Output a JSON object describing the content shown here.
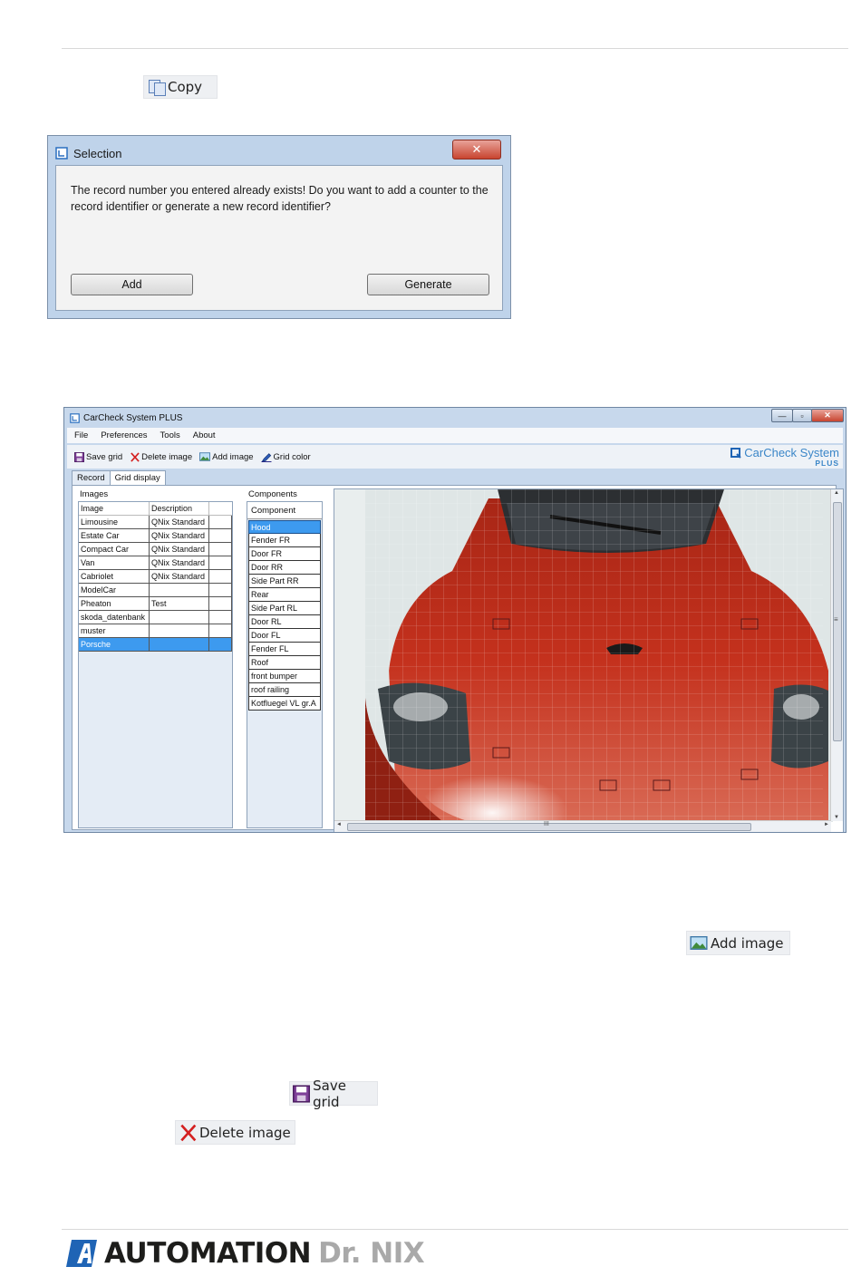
{
  "doc": {
    "copy_label": "Copy",
    "add_image_label": "Add image",
    "save_grid_label": "Save grid",
    "delete_image_label": "Delete image"
  },
  "dialog": {
    "title": "Selection",
    "close_glyph": "✕",
    "message": "The record number you entered already exists! Do you want to add a counter to the record identifier or generate a new record identifier?",
    "add_button": "Add",
    "generate_button": "Generate"
  },
  "app": {
    "title": "CarCheck System PLUS",
    "window_controls": {
      "minimize": "—",
      "maximize": "▫",
      "close": "✕"
    },
    "menu": [
      "File",
      "Preferences",
      "Tools",
      "About"
    ],
    "toolbar": {
      "save_grid": "Save grid",
      "delete_image": "Delete image",
      "add_image": "Add image",
      "grid_color": "Grid color"
    },
    "brand": {
      "name": "CarCheck System",
      "plus": "PLUS"
    },
    "tabs": [
      "Record",
      "Grid display"
    ],
    "active_tab": "Grid display",
    "images_panel": {
      "label": "Images",
      "columns": [
        "Image",
        "Description"
      ],
      "rows": [
        {
          "image": "Limousine",
          "description": "QNix Standard"
        },
        {
          "image": "Estate Car",
          "description": "QNix Standard"
        },
        {
          "image": "Compact Car",
          "description": "QNix Standard"
        },
        {
          "image": "Van",
          "description": "QNix Standard"
        },
        {
          "image": "Cabriolet",
          "description": "QNix Standard"
        },
        {
          "image": "ModelCar",
          "description": ""
        },
        {
          "image": "Pheaton",
          "description": "Test"
        },
        {
          "image": "skoda_datenbank",
          "description": ""
        },
        {
          "image": "muster",
          "description": ""
        },
        {
          "image": "Porsche",
          "description": ""
        }
      ],
      "selected": "Porsche"
    },
    "components_panel": {
      "label": "Components",
      "column": "Component",
      "rows": [
        "Hood",
        "Fender FR",
        "Door FR",
        "Door RR",
        "Side Part RR",
        "Rear",
        "Side Part RL",
        "Door RL",
        "Door FL",
        "Fender FL",
        "Roof",
        "front bumper",
        "roof railing",
        "Kotfluegel VL gr.A"
      ],
      "selected": "Hood"
    },
    "scrollbar_glyphs": {
      "up": "▲",
      "down": "▼",
      "left": "◄",
      "right": "►",
      "grip_v": "≡",
      "grip_h": "III"
    }
  },
  "footer": {
    "logo_main": "AUTOMATION",
    "logo_sub": "Dr. NIX"
  },
  "colors": {
    "selection_blue": "#3d9aef",
    "car_red": "#c4311d",
    "dialog_frame": "#bfd3ea",
    "logo_blue": "#1f64b5"
  }
}
